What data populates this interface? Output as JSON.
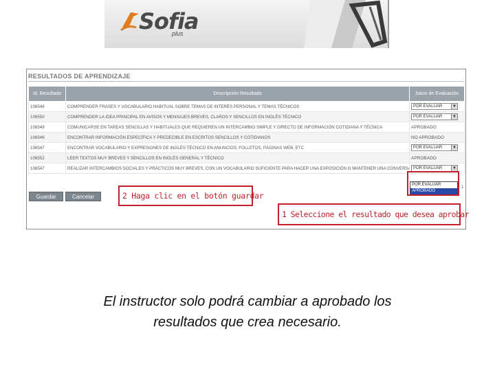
{
  "header": {
    "logo_text": "Sofia",
    "logo_sub": "plus"
  },
  "section": {
    "title": "RESULTADOS DE APRENDIZAJE"
  },
  "table": {
    "columns": [
      "Id. Resultado",
      "Descripción Resultado",
      "Juicio de Evaluación"
    ],
    "rows": [
      {
        "id": "106548",
        "desc": "COMPRENDER FRASES Y VOCABULARIO HABITUAL SOBRE TEMAS DE INTERÉS PERSONAL Y TEMAS TÉCNICOS",
        "result": "POR EVALUAR",
        "type": "select"
      },
      {
        "id": "106550",
        "desc": "COMPRENDER LA IDEA PRINCIPAL EN AVISOS Y MENSAJES BREVES, CLAROS Y SENCILLOS EN INGLÉS TÉCNICO",
        "result": "POR EVALUAR",
        "type": "select"
      },
      {
        "id": "106549",
        "desc": "COMUNICARSE EN TAREAS SENCILLAS Y HABITUALES QUE REQUIEREN UN INTERCAMBIO SIMPLE Y DIRECTO DE INFORMACIÓN COTIDIANA Y TÉCNICA",
        "result": "APROBADO",
        "type": "text"
      },
      {
        "id": "106546",
        "desc": "ENCONTRAR INFORMACIÓN ESPECÍFICA Y PREDECIBLE EN ESCRITOS SENCILLOS Y COTIDIANOS",
        "result": "NO APROBADO",
        "type": "text"
      },
      {
        "id": "106547",
        "desc": "ENCONTRAR VOCABULARIO Y EXPRESIONES DE INGLÉS TÉCNICO EN ANUNCIOS, FOLLETOS, PÁGINAS WEB, ETC",
        "result": "POR EVALUAR",
        "type": "select"
      },
      {
        "id": "106552",
        "desc": "LEER TEXTOS MUY BREVES Y SENCILLOS EN INGLÉS GENERAL Y TÉCNICO",
        "result": "APROBADO",
        "type": "text"
      },
      {
        "id": "106547",
        "desc": "REALIZAR INTERCAMBIOS SOCIALES Y PRÁCTICOS MUY BREVES, CON UN VOCABULARIO SUFICIENTE PARA HACER UNA EXPOSICIÓN O MANTENER UNA CONVERSACIÓN SENCILLA SOBRE TEMAS TÉCNICOS",
        "result": "POR EVALUAR",
        "type": "select"
      }
    ]
  },
  "dropdown": {
    "options": [
      "POR EVALUAR",
      "APROBADO"
    ],
    "selected": "APROBADO"
  },
  "side_mark": "1",
  "buttons": {
    "save": "Guardar",
    "cancel": "Cancelar"
  },
  "callouts": {
    "step2": "2 Haga clic en el botón guardar",
    "step1": "1 Seleccione el resultado que desea aprobar"
  },
  "caption": {
    "line1": "El instructor solo podrá cambiar a aprobado los",
    "line2": "resultados que crea necesario."
  },
  "colors": {
    "accent_red": "#c0202a",
    "header_gray": "#9aa2aa",
    "dropdown_highlight": "#2a48a8"
  }
}
